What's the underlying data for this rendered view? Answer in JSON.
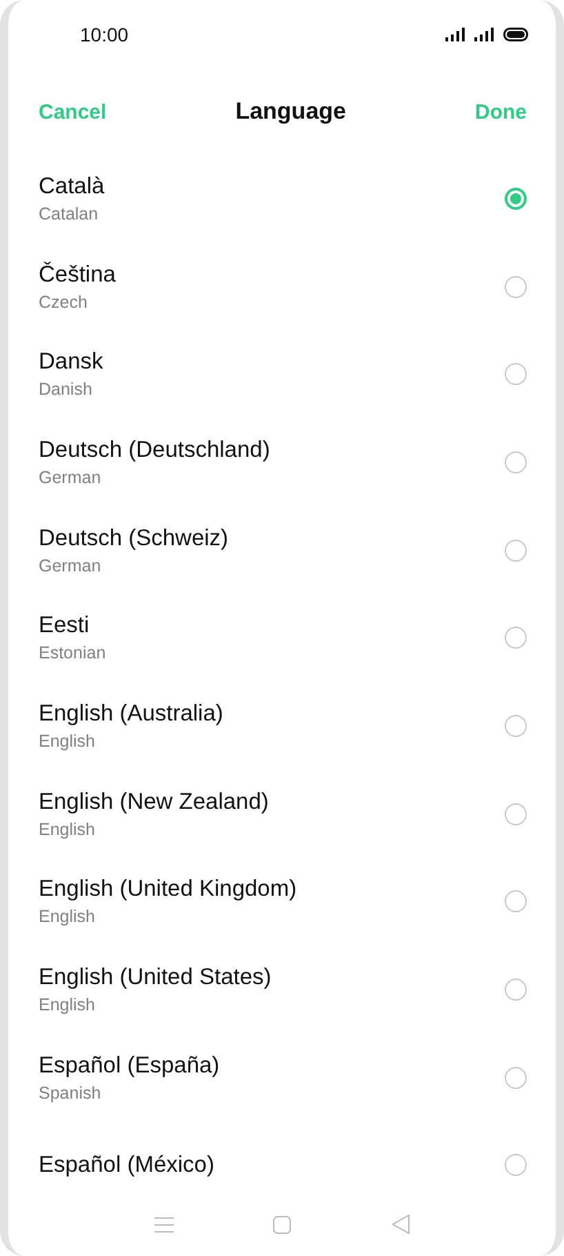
{
  "status_bar": {
    "time": "10:00"
  },
  "header": {
    "cancel": "Cancel",
    "title": "Language",
    "done": "Done"
  },
  "languages": [
    {
      "name": "Català",
      "subtitle": "Catalan",
      "selected": true
    },
    {
      "name": "Čeština",
      "subtitle": "Czech",
      "selected": false
    },
    {
      "name": "Dansk",
      "subtitle": "Danish",
      "selected": false
    },
    {
      "name": "Deutsch (Deutschland)",
      "subtitle": "German",
      "selected": false
    },
    {
      "name": "Deutsch (Schweiz)",
      "subtitle": "German",
      "selected": false
    },
    {
      "name": "Eesti",
      "subtitle": "Estonian",
      "selected": false
    },
    {
      "name": "English (Australia)",
      "subtitle": "English",
      "selected": false
    },
    {
      "name": "English (New Zealand)",
      "subtitle": "English",
      "selected": false
    },
    {
      "name": "English (United Kingdom)",
      "subtitle": "English",
      "selected": false
    },
    {
      "name": "English (United States)",
      "subtitle": "English",
      "selected": false
    },
    {
      "name": "Español (España)",
      "subtitle": "Spanish",
      "selected": false
    },
    {
      "name": "Español (México)",
      "selected": false
    }
  ]
}
